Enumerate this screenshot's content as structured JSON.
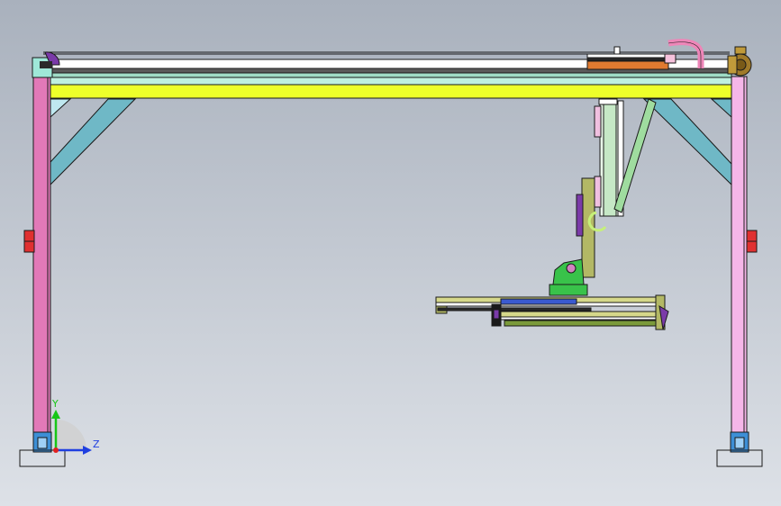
{
  "viewport": {
    "background_top": "#a9b1bd",
    "background_bottom": "#dde1e7"
  },
  "triad": {
    "y_label": "Y",
    "z_label": "Z",
    "y_color": "#17c617",
    "z_color": "#1f3fe0",
    "x_color": "#e02020"
  },
  "colors": {
    "left_column": "#e279b8",
    "right_column": "#f5b6e8",
    "main_beam": "#eeff2a",
    "rail": "#9fdcc6",
    "brace": "#6fb8c6",
    "base_plate": "#3d8fd6",
    "arm_green": "#39c24a",
    "arm_olive": "#b3b865",
    "arm_purple": "#7a3aa8",
    "cable_pink": "#ee86b8",
    "limit_switch": "#e03030",
    "motor_bronze": "#a07a2a",
    "outline": "#1a1a1a"
  }
}
